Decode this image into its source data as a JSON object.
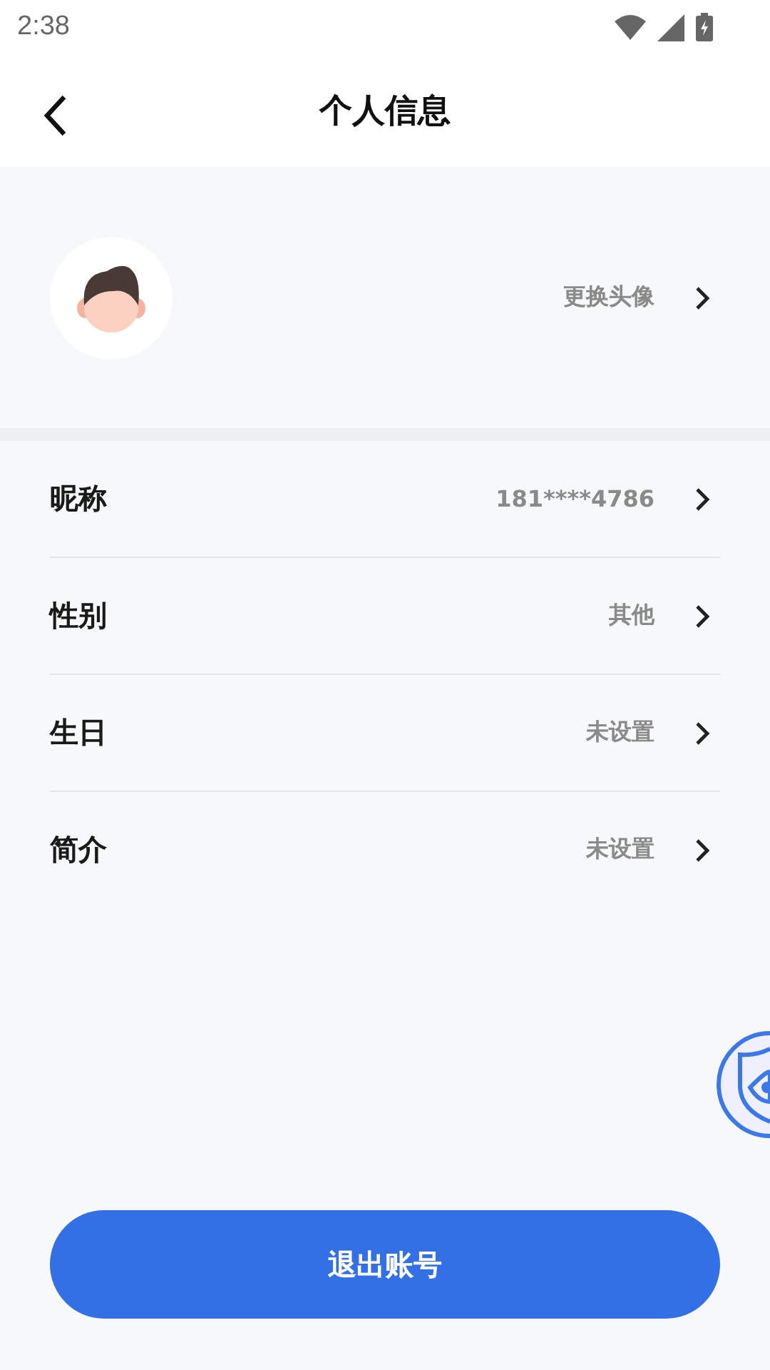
{
  "status_bar": {
    "time": "2:38"
  },
  "header": {
    "title": "个人信息"
  },
  "avatar_row": {
    "action": "更换头像"
  },
  "rows": [
    {
      "label": "昵称",
      "value": "181****4786"
    },
    {
      "label": "性别",
      "value": "其他"
    },
    {
      "label": "生日",
      "value": "未设置"
    },
    {
      "label": "简介",
      "value": "未设置"
    }
  ],
  "logout_button": "退出账号"
}
